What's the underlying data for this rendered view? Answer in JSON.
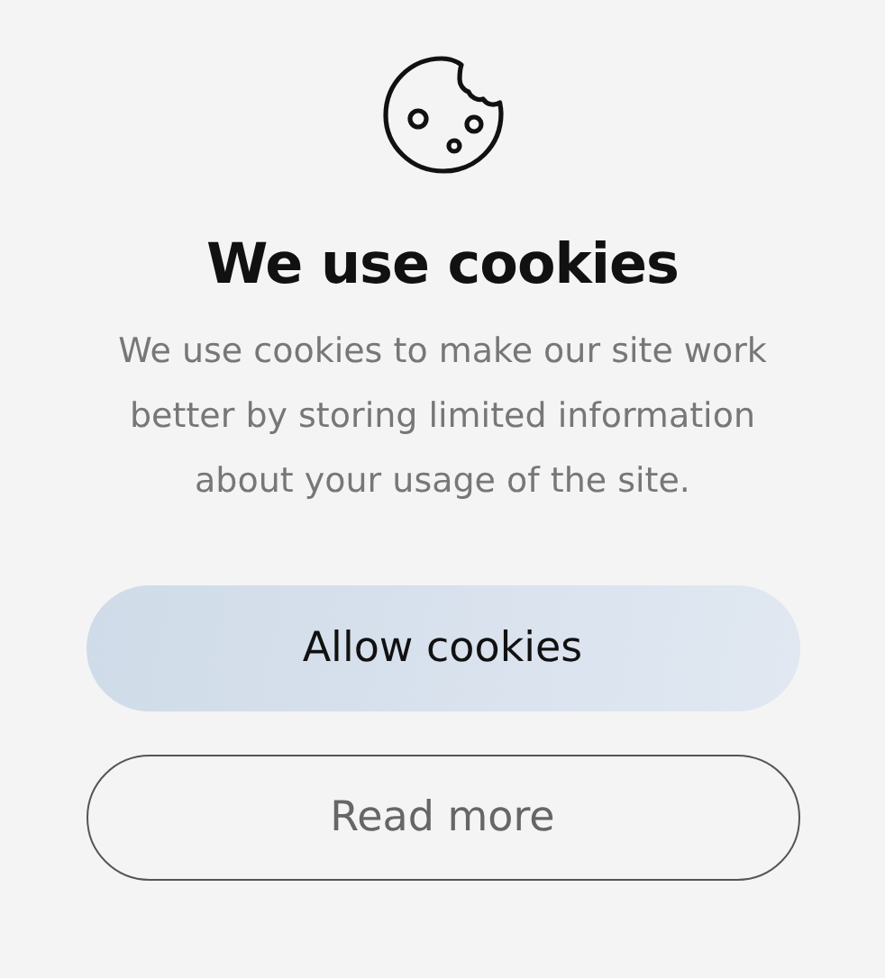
{
  "dialog": {
    "title": "We use cookies",
    "message": "We use cookies to make our site work better by storing limited information about your usage of the site.",
    "buttons": [
      {
        "label": "Allow cookies",
        "kind": "primary"
      },
      {
        "label": "Read more",
        "kind": "secondary"
      }
    ]
  }
}
